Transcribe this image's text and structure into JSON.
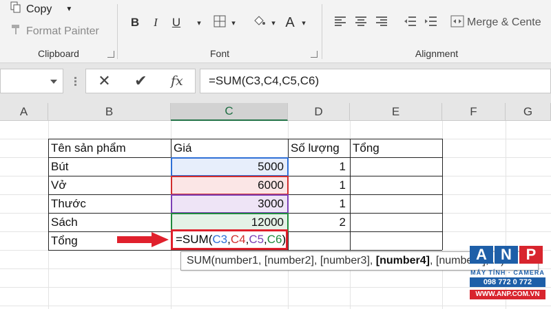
{
  "ribbon": {
    "clipboard": {
      "label": "Clipboard",
      "copy_label": "Copy",
      "format_painter_label": "Format Painter"
    },
    "font": {
      "label": "Font",
      "bold": "B",
      "italic": "I",
      "underline": "U",
      "font_color_glyph": "A"
    },
    "alignment": {
      "label": "Alignment",
      "merge_label": "Merge & Cente"
    }
  },
  "formula_bar": {
    "cancel_glyph": "✕",
    "enter_glyph": "✔",
    "fx_glyph": "fx",
    "formula": "=SUM(C3,C4,C5,C6)"
  },
  "columns": [
    "A",
    "B",
    "C",
    "D",
    "E",
    "F",
    "G"
  ],
  "selected_column": "C",
  "table": {
    "headers": [
      "Tên sản phẩm",
      "Giá",
      "Số lượng",
      "Tổng"
    ],
    "rows": [
      {
        "name": "Bút",
        "price": "5000",
        "qty": "1"
      },
      {
        "name": "Vở",
        "price": "6000",
        "qty": "1"
      },
      {
        "name": "Thước",
        "price": "3000",
        "qty": "1"
      },
      {
        "name": "Sách",
        "price": "12000",
        "qty": "2"
      }
    ],
    "total_label": "Tổng"
  },
  "edit_cell": {
    "prefix": "=SUM(",
    "refs": [
      {
        "text": "C3",
        "color": "#2e6fd6"
      },
      {
        "text": "C4",
        "color": "#d12d2d"
      },
      {
        "text": "C5",
        "color": "#7b3fb5"
      },
      {
        "text": "C6",
        "color": "#1f8a3c"
      }
    ],
    "suffix": ")"
  },
  "tooltip": {
    "part1": "SUM(number1, [number2], [number3], ",
    "bold": "[number4]",
    "part2": ", [number5], ...)"
  },
  "logo": {
    "letters": [
      "A",
      "N",
      "P"
    ],
    "subtitle": "MÁY TÍNH · CAMERA",
    "phone": "098 772 0 772",
    "web": "WWW.ANP.COM.VN"
  },
  "colors": {
    "ref_blue": "#2e6fd6",
    "ref_red": "#d12d2d",
    "ref_purple": "#7b3fb5",
    "ref_green": "#1f8a3c",
    "edit_border": "#e0202c",
    "excel_green": "#217346"
  }
}
